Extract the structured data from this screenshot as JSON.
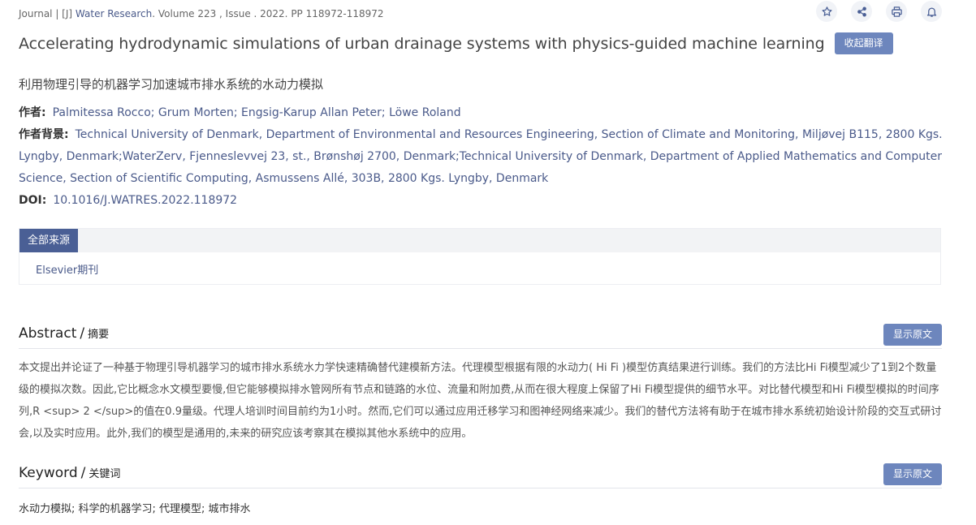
{
  "journal": {
    "prefix": "Journal | [J]",
    "name": "Water Research",
    "details": ". Volume 223 , Issue . 2022. PP 118972-118972"
  },
  "actions": {
    "icons": [
      "star-icon",
      "share-icon",
      "print-icon",
      "bell-icon"
    ]
  },
  "title": {
    "en": "Accelerating hydrodynamic simulations of urban drainage systems with physics-guided machine learning",
    "collapse_label": "收起翻译",
    "cn": "利用物理引导的机器学习加速城市排水系统的水动力模拟"
  },
  "authors": {
    "label": "作者:",
    "value": "Palmitessa Rocco; Grum Morten; Engsig-Karup Allan Peter; Löwe Roland"
  },
  "affiliation": {
    "label": "作者背景:",
    "value": "Technical University of Denmark, Department of Environmental and Resources Engineering, Section of Climate and Monitoring, Miljøvej B115, 2800 Kgs. Lyngby, Denmark;WaterZerv, Fjenneslevvej 23, st., Brønshøj 2700, Denmark;Technical University of Denmark, Department of Applied Mathematics and Computer Science, Section of Scientific Computing, Asmussens Allé, 303B, 2800 Kgs. Lyngby, Denmark"
  },
  "doi": {
    "label": "DOI:",
    "value": "10.1016/J.WATRES.2022.118972"
  },
  "sources": {
    "tab_label": "全部来源",
    "items": [
      "Elsevier期刊"
    ]
  },
  "abstract": {
    "title_en": "Abstract",
    "separator": "/",
    "title_cn": "摘要",
    "show_label": "显示原文",
    "text": "本文提出并论证了一种基于物理引导机器学习的城市排水系统水力学快速精确替代建模新方法。代理模型根据有限的水动力( Hi Fi )模型仿真结果进行训练。我们的方法比Hi Fi模型减少了1到2个数量级的模拟次数。因此,它比概念水文模型要慢,但它能够模拟排水管网所有节点和链路的水位、流量和附加费,从而在很大程度上保留了Hi Fi模型提供的细节水平。对比替代模型和Hi Fi模型模拟的时间序列,R <sup> 2 </sup>的值在0.9量级。代理人培训时间目前约为1小时。然而,它们可以通过应用迁移学习和图神经网络来减少。我们的替代方法将有助于在城市排水系统初始设计阶段的交互式研讨会,以及实时应用。此外,我们的模型是通用的,未来的研究应该考察其在模拟其他水系统中的应用。"
  },
  "keyword": {
    "title_en": "Keyword",
    "separator": "/",
    "title_cn": "关键词",
    "show_label": "显示原文",
    "text": "水动力模拟;  科学的机器学习;  代理模型;  城市排水"
  }
}
